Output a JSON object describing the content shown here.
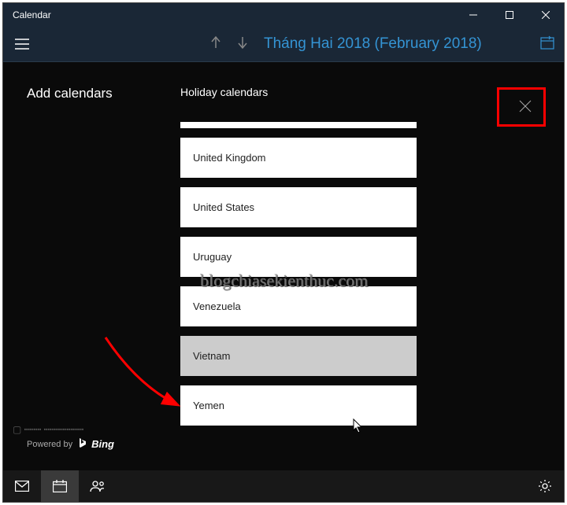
{
  "titlebar": {
    "title": "Calendar"
  },
  "header": {
    "month": "Tháng Hai 2018 (February 2018)"
  },
  "addCalendars": {
    "title": "Add calendars",
    "section": "Holiday calendars",
    "poweredBy": "Powered by",
    "provider": "Bing"
  },
  "countries": [
    {
      "label": ""
    },
    {
      "label": "United Kingdom"
    },
    {
      "label": "United States"
    },
    {
      "label": "Uruguay"
    },
    {
      "label": "Venezuela"
    },
    {
      "label": "Vietnam",
      "hovered": true
    },
    {
      "label": "Yemen"
    }
  ],
  "watermark": "blogchiasekienthuc.com"
}
